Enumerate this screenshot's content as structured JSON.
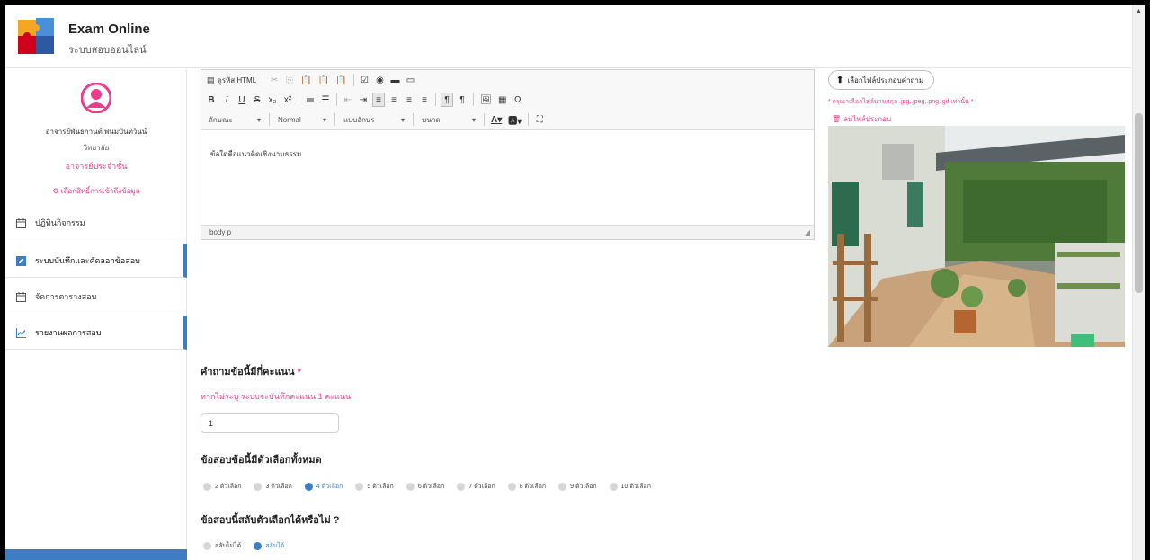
{
  "header": {
    "title": "Exam Online",
    "subtitle": "ระบบสอบออนไลน์"
  },
  "sidebar": {
    "user_name": "อาจารย์พันธกานต์ พนมบันทวินน์",
    "user_org": "วิทยาลัย",
    "user_role": "อาจารย์ประจำชั้น",
    "perm_link": "เลือกสิทธิ์การเข้าถึงข้อมูล",
    "items": [
      {
        "label": "ปฏิทินกิจกรรม"
      },
      {
        "label": "ระบบบันทึกและคัดลอกข้อสอบ"
      },
      {
        "label": "จัดการตารางสอบ"
      },
      {
        "label": "รายงานผลการสอบ"
      }
    ]
  },
  "editor": {
    "source_label": "ดูรหัส HTML",
    "style_dd": "ลักษณะ",
    "format_dd": "Normal",
    "font_dd": "แบบอักษร",
    "size_dd": "ขนาด",
    "content": "ข้อใดคือแนวคิดเชิงนามธรรม",
    "status_path": "body  p"
  },
  "attachment": {
    "upload_label": "เลือกไฟล์ประกอบคำถาม",
    "hint": "* กรุณาเลือกไฟล์นามสกุล .jpg,.jpeg,.png,.gif เท่านั้น *",
    "delete_label": "ลบไฟล์ประกอบ"
  },
  "form": {
    "score_label": "คำถามข้อนี้มีกี่คะแนน",
    "score_required": "*",
    "score_hint": "หากไม่ระบุ ระบบจะบันทึกคะแนน 1 คะแนน",
    "score_value": "1",
    "choices_label": "ข้อสอบข้อนี้มีตัวเลือกทั้งหมด",
    "choice_options": [
      "2 ตัวเลือก",
      "3 ตัวเลือก",
      "4 ตัวเลือก",
      "5 ตัวเลือก",
      "6 ตัวเลือก",
      "7 ตัวเลือก",
      "8 ตัวเลือก",
      "9 ตัวเลือก",
      "10 ตัวเลือก"
    ],
    "choice_selected": "4 ตัวเลือก",
    "shuffle_label": "ข้อสอบนี้สลับตัวเลือกได้หรือไม่ ?",
    "shuffle_options": [
      "สลับไม่ได้",
      "สลับได้"
    ],
    "shuffle_selected": "สลับได้"
  },
  "colors": {
    "accent": "#3b7ec4",
    "pink": "#e83e8c"
  }
}
